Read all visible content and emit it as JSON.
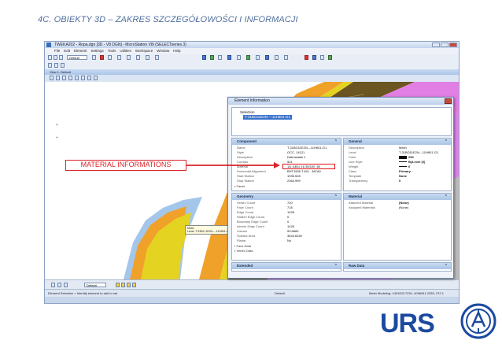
{
  "slide": {
    "title": "4C. OBIEKTY 3D – ZAKRES SZCZEGÓŁOWOŚCI I INFORMACJI",
    "callout": "MATERIAL INFORMATIONS"
  },
  "app": {
    "title": "TWEKA202 - Ropa.dgn [3D - V8 DGN] - MicroStation V8i (SELECTseries 3)",
    "menu": [
      "File",
      "Edit",
      "Element",
      "Settings",
      "Tools",
      "Utilities",
      "Workspace",
      "Window",
      "Help"
    ],
    "level_select": "Default",
    "view_title": "View 1, Default",
    "bottom_level_select": "Default",
    "status_left": "Element Selection > Identify element to add to set",
    "status_mid": "Default",
    "status_right": "Mesh Modeling: 1491003.7291, 4096041.2339, 272.1"
  },
  "tooltip": {
    "line1": "Mesh",
    "line2": "Level: T-31BC-1E2N----11H601-G1"
  },
  "dialog": {
    "title": "Element Information",
    "tree_root": "Selection",
    "tree_item": "T-31BC61E2N----11H601-G1",
    "component": {
      "header": "Component",
      "rows": [
        {
          "k": "Name",
          "v": "T-31BC61E2N---11H601-G1"
        },
        {
          "k": "Style",
          "v": "OCC. 14121"
        },
        {
          "k": "Description",
          "v": "Dabowaatu 1"
        },
        {
          "k": "Corridor",
          "v": "501"
        },
        {
          "k": "Material",
          "v": "1A. AB1c 16 35/100 .60"
        },
        {
          "k": "Horizontal Alignment",
          "v": "BHT1506 T 601 - MCA0"
        },
        {
          "k": "Start Station",
          "v": "1935.528"
        },
        {
          "k": "Stop Station",
          "v": "2364.999"
        }
      ],
      "expander": "Faces"
    },
    "general": {
      "header": "General",
      "rows": [
        {
          "k": "Description",
          "v": "Mesh"
        },
        {
          "k": "Level",
          "v": "T-31BC61E2N---11H601-G1"
        },
        {
          "k": "Color",
          "v": "250"
        },
        {
          "k": "Line Style",
          "v": "ByLevel (0)"
        },
        {
          "k": "Weight",
          "v": "0"
        },
        {
          "k": "Class",
          "v": "Primary"
        },
        {
          "k": "Template",
          "v": "None"
        },
        {
          "k": "Transparency",
          "v": "0"
        }
      ]
    },
    "geometry": {
      "header": "Geometry",
      "rows": [
        {
          "k": "Vertex Count",
          "v": "720"
        },
        {
          "k": "Face Count",
          "v": "718"
        },
        {
          "k": "Edge Count",
          "v": "1428"
        },
        {
          "k": "Hidden Edge Count",
          "v": "0"
        },
        {
          "k": "Boundary Edge Count",
          "v": "0"
        },
        {
          "k": "Interior Edge Count",
          "v": "1428"
        },
        {
          "k": "Volume",
          "v": "59.8889"
        },
        {
          "k": "Surface Area",
          "v": "3644.6340"
        },
        {
          "k": "Planar",
          "v": "No"
        }
      ],
      "expanders": [
        "Face Data",
        "Vertex Data"
      ]
    },
    "material": {
      "header": "Material",
      "rows": [
        {
          "k": "Attached Material",
          "v": "(None)"
        },
        {
          "k": "Assigned Materials",
          "v": "(None)"
        }
      ]
    },
    "extended_header": "Extended",
    "raw_data_header": "Raw Data"
  },
  "logos": {
    "company": "URS"
  },
  "colors": {
    "title_blue": "#4f6f9f",
    "callout_red": "#d9242a",
    "road_magenta": "#e17fe4",
    "road_orange": "#f0a12a",
    "road_yellow": "#e5d321",
    "urs_blue": "#1b4aa0"
  }
}
